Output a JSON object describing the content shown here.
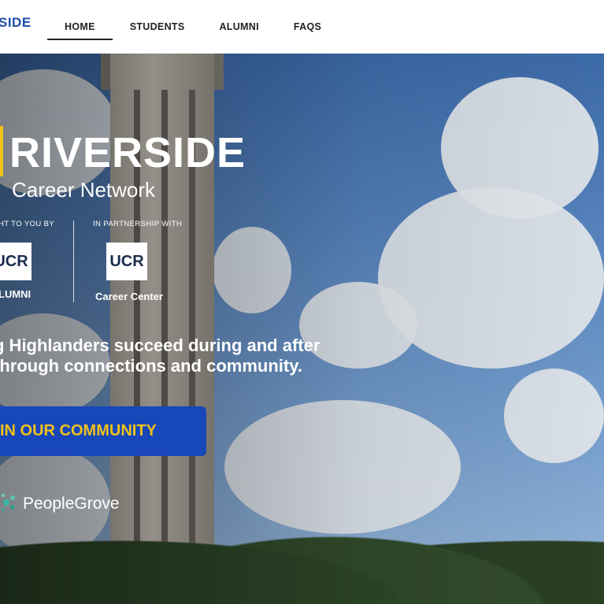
{
  "header": {
    "brand": "SIDE",
    "nav": [
      {
        "label": "HOME",
        "active": true
      },
      {
        "label": "STUDENTS",
        "active": false
      },
      {
        "label": "ALUMNI",
        "active": false
      },
      {
        "label": "FAQS",
        "active": false
      }
    ]
  },
  "hero": {
    "logo_title": "RIVERSIDE",
    "logo_subtitle": "Career Network",
    "brought_caption": "HT TO YOU BY",
    "partnership_caption": "IN PARTNERSHIP WITH",
    "badge_left_text": "UCR",
    "badge_left_label": "LUMNI",
    "badge_right_text": "UCR",
    "badge_right_label": "Career Center",
    "tagline_line1": "g Highlanders succeed during and after",
    "tagline_line2": " through connections and community.",
    "cta_label": "IN OUR COMMUNITY",
    "powered_by": "PeopleGrove",
    "accent_color": "#f0c417",
    "cta_color": "#1747b8"
  }
}
